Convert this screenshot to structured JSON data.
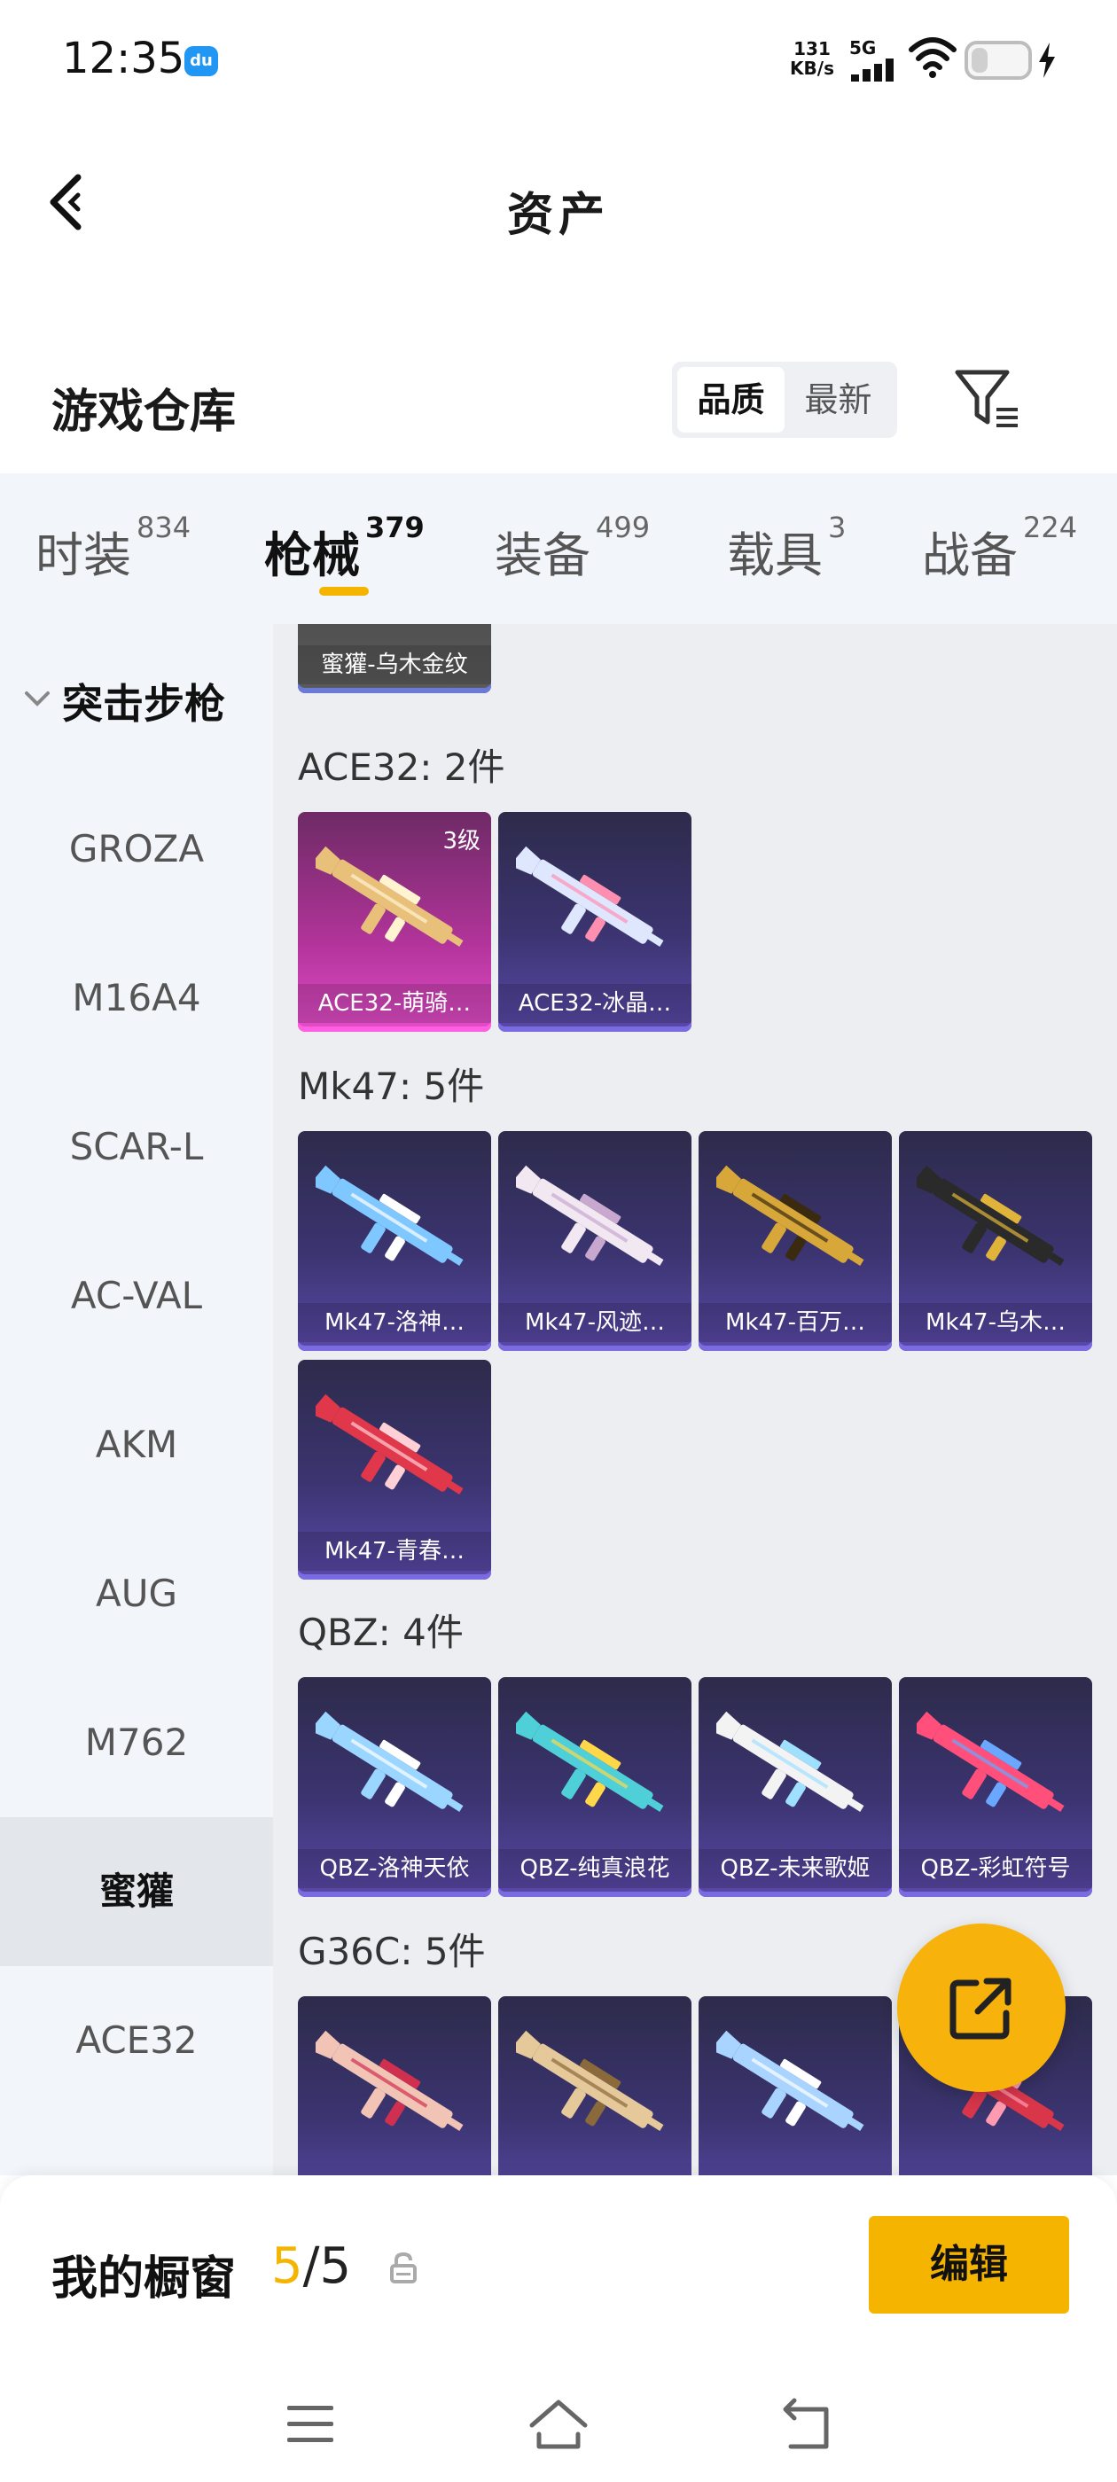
{
  "status_bar": {
    "time": "12:35",
    "app_badge": "du",
    "net_speed_value": "131",
    "net_speed_unit": "KB/s",
    "network": "5G",
    "battery_percent": 30
  },
  "header": {
    "title": "资产"
  },
  "section": {
    "title": "游戏仓库",
    "sort_options": [
      "品质",
      "最新"
    ],
    "active_sort": "品质"
  },
  "tabs": [
    {
      "label": "时装",
      "count": "834"
    },
    {
      "label": "枪械",
      "count": "379"
    },
    {
      "label": "装备",
      "count": "499"
    },
    {
      "label": "载具",
      "count": "3"
    },
    {
      "label": "战备",
      "count": "224"
    }
  ],
  "active_tab": "枪械",
  "sidebar": {
    "group_label": "突击步枪",
    "items": [
      "GROZA",
      "M16A4",
      "SCAR-L",
      "AC-VAL",
      "AKM",
      "AUG",
      "M762",
      "蜜獾",
      "ACE32"
    ],
    "active_item": "蜜獾"
  },
  "content": {
    "partial_top_card": {
      "name": "蜜獾-乌木金纹"
    },
    "groups": [
      {
        "label": "ACE32: 2件",
        "cards": [
          {
            "name": "ACE32-萌骑…",
            "level": "3级",
            "style": "pink",
            "gun_color": "#e8c07a",
            "accent": "#fff3d0"
          },
          {
            "name": "ACE32-冰晶…",
            "level": "",
            "style": "purple",
            "gun_color": "#dfe7ff",
            "accent": "#ff8fb0"
          }
        ]
      },
      {
        "label": "Mk47: 5件",
        "cards": [
          {
            "name": "Mk47-洛神…",
            "level": "",
            "style": "purple",
            "gun_color": "#7fc7ff",
            "accent": "#ffffff"
          },
          {
            "name": "Mk47-风迹…",
            "level": "",
            "style": "purple",
            "gun_color": "#f1e8f2",
            "accent": "#c9a8d0"
          },
          {
            "name": "Mk47-百万…",
            "level": "",
            "style": "purple",
            "gun_color": "#d7a73a",
            "accent": "#3a2a10"
          },
          {
            "name": "Mk47-乌木…",
            "level": "",
            "style": "purple",
            "gun_color": "#2a2a2a",
            "accent": "#e0b43a"
          },
          {
            "name": "Mk47-青春…",
            "level": "",
            "style": "purple",
            "gun_color": "#e0374a",
            "accent": "#ffd0d5"
          }
        ]
      },
      {
        "label": "QBZ: 4件",
        "cards": [
          {
            "name": "QBZ-洛神天依",
            "level": "",
            "style": "purple",
            "gun_color": "#9ad6ff",
            "accent": "#ffffff"
          },
          {
            "name": "QBZ-纯真浪花",
            "level": "",
            "style": "purple",
            "gun_color": "#4fd0d8",
            "accent": "#ffd84a"
          },
          {
            "name": "QBZ-未来歌姬",
            "level": "",
            "style": "purple",
            "gun_color": "#f3f3f3",
            "accent": "#9fe0ff"
          },
          {
            "name": "QBZ-彩虹符号",
            "level": "",
            "style": "purple",
            "gun_color": "#ff4f7a",
            "accent": "#6aa8ff"
          }
        ]
      },
      {
        "label": "G36C: 5件",
        "cards": [
          {
            "name": "",
            "level": "",
            "style": "purple",
            "gun_color": "#f2c4b6",
            "accent": "#d03050"
          },
          {
            "name": "",
            "level": "",
            "style": "purple",
            "gun_color": "#e6c99a",
            "accent": "#8a6a3a"
          },
          {
            "name": "",
            "level": "",
            "style": "purple",
            "gun_color": "#a8d4ff",
            "accent": "#ffffff"
          },
          {
            "name": "",
            "level": "",
            "style": "purple",
            "gun_color": "#d9364a",
            "accent": "#ff9bb0"
          }
        ]
      }
    ]
  },
  "showcase": {
    "label": "我的橱窗",
    "current": "5",
    "separator": "/",
    "total": "5",
    "edit_label": "编辑"
  },
  "colors": {
    "accent": "#f5b400",
    "card_purple": "#3b3470",
    "card_pink": "#b2349a"
  }
}
